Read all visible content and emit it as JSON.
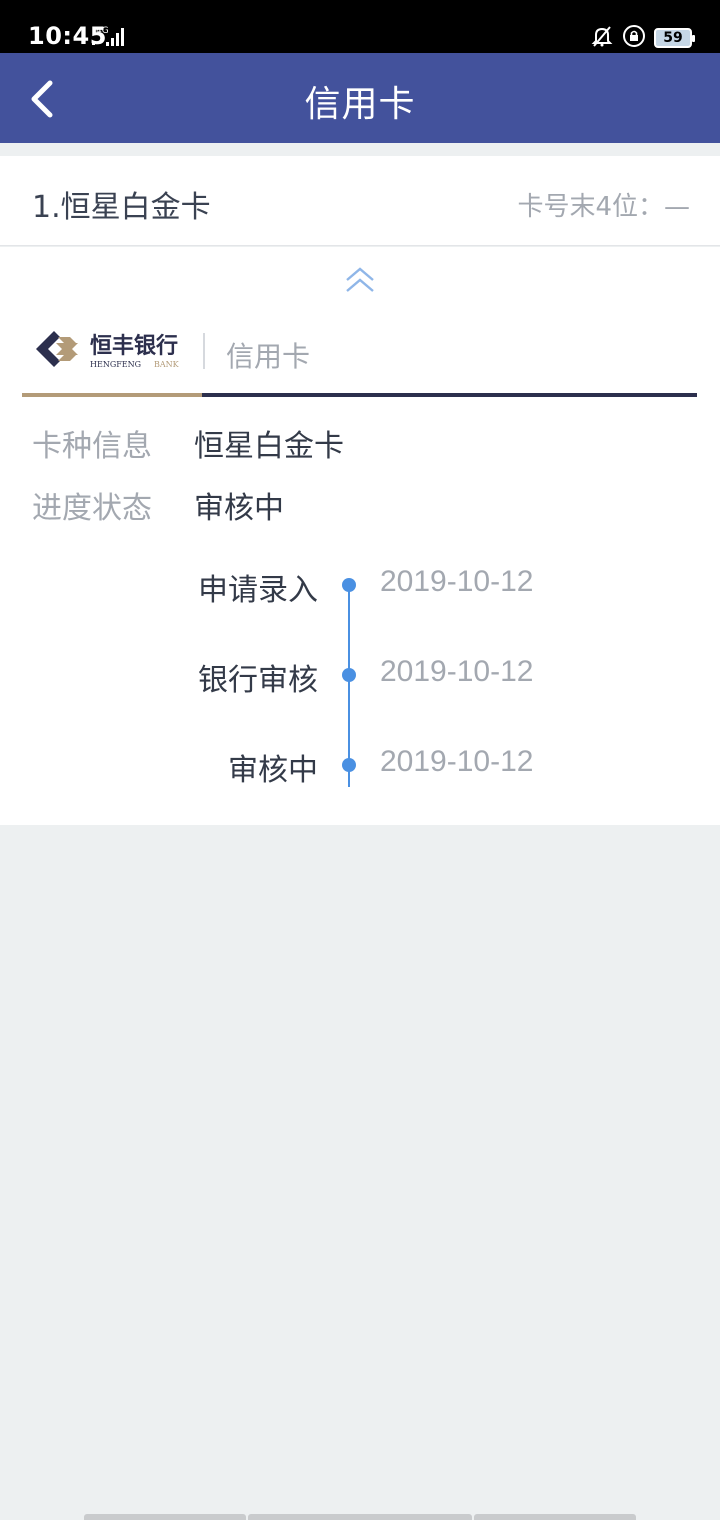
{
  "status_bar": {
    "time": "10:45",
    "network": "4G",
    "battery": "59"
  },
  "nav": {
    "title": "信用卡",
    "back_icon": "chevron-left-icon"
  },
  "card": {
    "name": "1.恒星白金卡",
    "tail_label": "卡号末4位：—",
    "collapse_icon": "double-chevron-up-icon",
    "bank_logo": {
      "name_cn": "恒丰银行",
      "name_en_left": "HENGFENG",
      "name_en_right": "BANK",
      "sub_label": "信用卡"
    },
    "info": [
      {
        "label": "卡种信息",
        "value": "恒星白金卡"
      },
      {
        "label": "进度状态",
        "value": "审核中"
      }
    ],
    "timeline": [
      {
        "label": "申请录入",
        "date": "2019-10-12"
      },
      {
        "label": "银行审核",
        "date": "2019-10-12"
      },
      {
        "label": "审核中",
        "date": "2019-10-12"
      }
    ]
  },
  "colors": {
    "nav_bg": "#43529c",
    "timeline_blue": "#4a90e2",
    "gold": "#b39b78",
    "navy": "#2c2f4d"
  }
}
